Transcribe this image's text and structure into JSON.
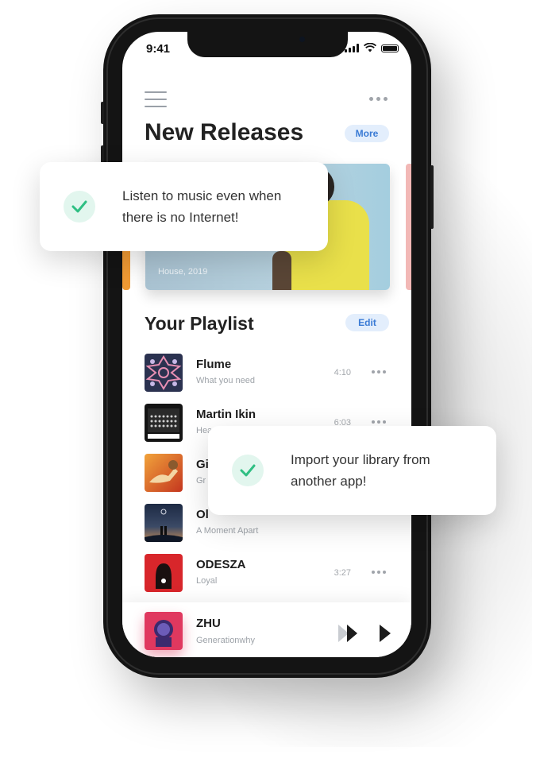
{
  "status_bar": {
    "time": "9:41"
  },
  "header": {
    "more_label": "More",
    "title": "New Releases"
  },
  "featured": {
    "meta": "House, 2019"
  },
  "playlist": {
    "title": "Your Playlist",
    "edit_label": "Edit",
    "tracks": [
      {
        "artist": "Flume",
        "title": "What you need",
        "duration": "4:10"
      },
      {
        "artist": "Martin Ikin",
        "title": "Headnoise",
        "duration": "6:03"
      },
      {
        "artist": "Gi",
        "title": "Gr",
        "duration": ""
      },
      {
        "artist": "Ol",
        "title": "A Moment Apart",
        "duration": ""
      },
      {
        "artist": "ODESZA",
        "title": "Loyal",
        "duration": "3:27"
      }
    ]
  },
  "now_playing": {
    "artist": "ZHU",
    "title": "Generationwhy"
  },
  "toasts": [
    {
      "line1": "Listen to music even when",
      "line2": "there is no Internet!"
    },
    {
      "line1": "Import your library from",
      "line2": "another app!"
    }
  ],
  "colors": {
    "accent": "#3a7bd5",
    "pill_bg": "#e3eefc",
    "check_green": "#2fbf83"
  },
  "icons": [
    "menu-icon",
    "more-icon",
    "check-icon",
    "fast-forward-icon",
    "play-icon",
    "signal-icon",
    "wifi-icon",
    "battery-icon"
  ]
}
